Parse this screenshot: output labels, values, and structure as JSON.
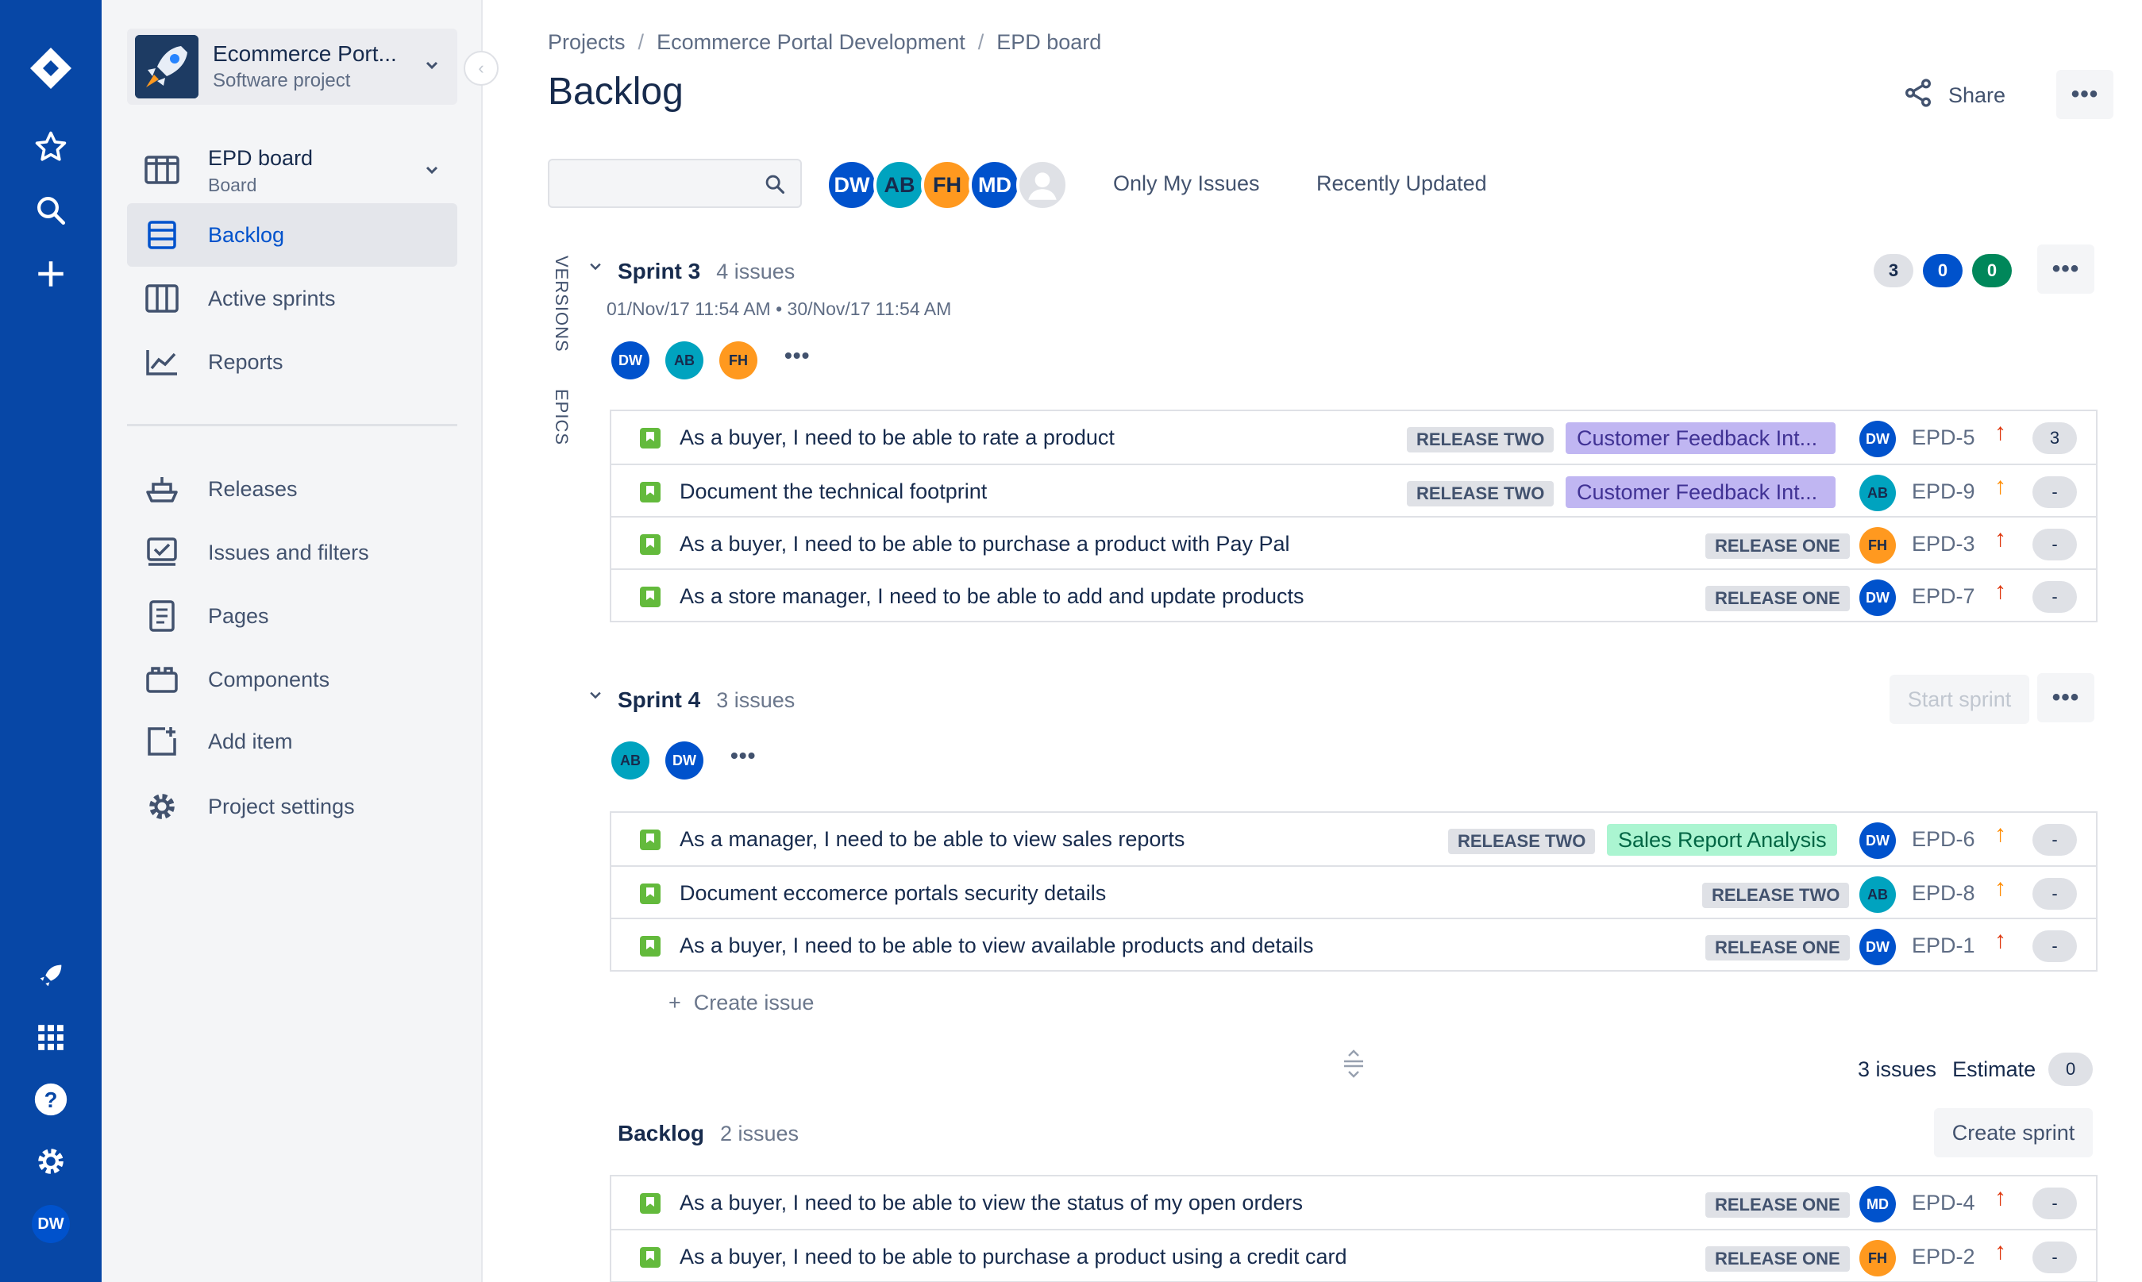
{
  "global_nav": {
    "icons": [
      "jira-logo-icon",
      "star-icon",
      "search-icon",
      "plus-icon",
      "rocket-icon",
      "app-switcher-icon",
      "help-icon",
      "settings-icon"
    ],
    "user_initials": "DW",
    "bg_color": "#0747a6"
  },
  "sidebar": {
    "project_name": "Ecommerce Port...",
    "project_type": "Software project",
    "board": {
      "label": "EPD board",
      "sub": "Board"
    },
    "items": [
      {
        "label": "Backlog",
        "icon": "backlog-icon",
        "active": true
      },
      {
        "label": "Active sprints",
        "icon": "columns-icon"
      },
      {
        "label": "Reports",
        "icon": "chart-icon"
      },
      {
        "label": "Releases",
        "icon": "ship-icon"
      },
      {
        "label": "Issues and filters",
        "icon": "issues-icon"
      },
      {
        "label": "Pages",
        "icon": "page-icon"
      },
      {
        "label": "Components",
        "icon": "component-icon"
      },
      {
        "label": "Add item",
        "icon": "add-item-icon"
      },
      {
        "label": "Project settings",
        "icon": "gear-icon"
      }
    ]
  },
  "header": {
    "breadcrumb": [
      "Projects",
      "Ecommerce Portal Development",
      "EPD board"
    ],
    "title": "Backlog",
    "share_label": "Share"
  },
  "filters": {
    "search_placeholder": "",
    "avatars": [
      {
        "initials": "DW",
        "color": "#0052cc"
      },
      {
        "initials": "AB",
        "color": "#00a3bf"
      },
      {
        "initials": "FH",
        "color": "#ff991f"
      },
      {
        "initials": "MD",
        "color": "#0052cc"
      }
    ],
    "quick_filters": [
      "Only My Issues",
      "Recently Updated"
    ]
  },
  "side_tabs": [
    "VERSIONS",
    "EPICS"
  ],
  "sprints": [
    {
      "name": "Sprint 3",
      "count": "4 issues",
      "dates": "01/Nov/17 11:54 AM  •  30/Nov/17 11:54 AM",
      "assignees": [
        "DW",
        "AB",
        "FH"
      ],
      "status_counts": [
        {
          "value": "3",
          "bg": "#dfe1e6",
          "fg": "#172b4d"
        },
        {
          "value": "0",
          "bg": "#0052cc",
          "fg": "#ffffff"
        },
        {
          "value": "0",
          "bg": "#00875a",
          "fg": "#ffffff"
        }
      ],
      "issues": [
        {
          "summary": "As a buyer, I need to be able to rate a product",
          "version": "RELEASE TWO",
          "epic": "Customer Feedback Int...",
          "epic_color": "#c0b6f2",
          "epic_text": "#403294",
          "assignee": "DW",
          "key": "EPD-5",
          "priority": "high",
          "estimate": "3"
        },
        {
          "summary": "Document the technical footprint",
          "version": "RELEASE TWO",
          "epic": "Customer Feedback Int...",
          "epic_color": "#c0b6f2",
          "epic_text": "#403294",
          "assignee": "AB",
          "key": "EPD-9",
          "priority": "medium",
          "estimate": "-"
        },
        {
          "summary": "As a buyer, I need to be able to purchase a product with Pay Pal",
          "version": "RELEASE ONE",
          "epic": "",
          "assignee": "FH",
          "key": "EPD-3",
          "priority": "high",
          "estimate": "-"
        },
        {
          "summary": "As a store manager, I need to be able to add and update products",
          "version": "RELEASE ONE",
          "epic": "",
          "assignee": "DW",
          "key": "EPD-7",
          "priority": "high",
          "estimate": "-"
        }
      ]
    },
    {
      "name": "Sprint 4",
      "count": "3 issues",
      "start_label": "Start sprint",
      "assignees": [
        "AB",
        "DW"
      ],
      "issues": [
        {
          "summary": "As a manager, I need to be able to view sales reports",
          "version": "RELEASE TWO",
          "epic": "Sales Report Analysis",
          "epic_color": "#abf5d1",
          "epic_text": "#006644",
          "assignee": "DW",
          "key": "EPD-6",
          "priority": "medium",
          "estimate": "-"
        },
        {
          "summary": "Document eccomerce portals security details",
          "version": "RELEASE TWO",
          "epic": "",
          "assignee": "AB",
          "key": "EPD-8",
          "priority": "medium",
          "estimate": "-"
        },
        {
          "summary": "As a buyer, I need to be able to view available products and details",
          "version": "RELEASE ONE",
          "epic": "",
          "assignee": "DW",
          "key": "EPD-1",
          "priority": "highest",
          "estimate": "-"
        }
      ],
      "create_issue_label": "Create issue",
      "footer": {
        "issues": "3 issues",
        "estimate_label": "Estimate",
        "estimate_value": "0"
      }
    }
  ],
  "backlog": {
    "name": "Backlog",
    "count": "2 issues",
    "create_sprint_label": "Create sprint",
    "issues": [
      {
        "summary": "As a buyer, I need to be able to view the status of my open orders",
        "version": "RELEASE ONE",
        "epic": "",
        "assignee": "MD",
        "key": "EPD-4",
        "priority": "high",
        "estimate": "-"
      },
      {
        "summary": "As a buyer, I need to be able to purchase a product using a credit card",
        "version": "RELEASE ONE",
        "epic": "",
        "assignee": "FH",
        "key": "EPD-2",
        "priority": "highest",
        "estimate": "-"
      }
    ]
  },
  "colors": {
    "accent": "#0052cc",
    "avatar_DW": "#0052cc",
    "avatar_AB": "#00a3bf",
    "avatar_FH": "#ff991f",
    "avatar_MD": "#0052cc",
    "priority_high": "#de350b",
    "priority_highest": "#de350b",
    "priority_medium": "#ff8b00"
  }
}
